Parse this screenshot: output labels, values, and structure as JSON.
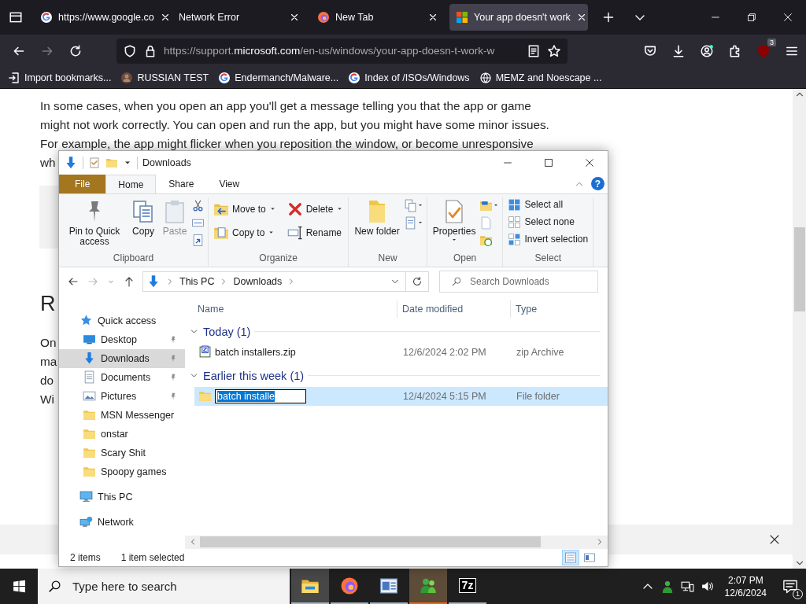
{
  "browser": {
    "tabs": [
      {
        "title": "https://www.google.co",
        "kind": "google",
        "selected": false
      },
      {
        "title": "Network Error",
        "kind": "none",
        "selected": false
      },
      {
        "title": "New Tab",
        "kind": "firefox",
        "selected": false
      },
      {
        "title": "Your app doesn't work",
        "kind": "microsoft",
        "selected": true
      }
    ],
    "forward": {
      "disabled": true
    },
    "url": {
      "scheme": "https://support.",
      "domain": "microsoft.com",
      "path": "/en-us/windows/your-app-doesn-t-work-w"
    },
    "extension_badge": "3",
    "bookmarks": [
      {
        "label": "Import bookmarks...",
        "kind": "import"
      },
      {
        "label": "RUSSIAN TEST",
        "kind": "avatar"
      },
      {
        "label": "Endermanch/Malware...",
        "kind": "google"
      },
      {
        "label": "Index of /ISOs/Windows",
        "kind": "google"
      },
      {
        "label": "MEMZ and Noescape ...",
        "kind": "globe"
      }
    ]
  },
  "page": {
    "intro_lines": [
      "In some cases, when you open an app you'll get a message telling you that the app or game",
      "might not work correctly. You can open and run the app, but you might have some minor issues.",
      "For example, the app might flicker when you reposition the window, or become unresponsive",
      "wh"
    ],
    "heading": "R",
    "body_lines": [
      "On",
      "ma",
      "do",
      "Wi"
    ]
  },
  "explorer": {
    "title": "Downloads",
    "help": "?",
    "ribbon_tabs": [
      {
        "label": "File",
        "kind": "file",
        "selected": false
      },
      {
        "label": "Home",
        "kind": "tab",
        "selected": true
      },
      {
        "label": "Share",
        "kind": "tab",
        "selected": false
      },
      {
        "label": "View",
        "kind": "tab",
        "selected": false
      }
    ],
    "ribbon_groups": [
      {
        "label": "Clipboard",
        "buttons": [
          {
            "label": "Pin to Quick access",
            "kind": "large",
            "dropdown": false,
            "disabled": false
          },
          {
            "label": "Copy",
            "kind": "large",
            "dropdown": false,
            "disabled": false
          },
          {
            "label": "Paste",
            "kind": "large",
            "dropdown": false,
            "disabled": true
          },
          {
            "kind": "stack"
          }
        ]
      },
      {
        "label": "Organize",
        "buttons": [
          {
            "label": "Move to",
            "kind": "small",
            "dropdown": true,
            "disabled": false
          },
          {
            "label": "Delete",
            "kind": "small",
            "dropdown": true,
            "disabled": false
          },
          {
            "label": "Copy to",
            "kind": "small",
            "dropdown": true,
            "disabled": false
          },
          {
            "label": "Rename",
            "kind": "small",
            "dropdown": false,
            "disabled": false
          }
        ]
      },
      {
        "label": "New",
        "buttons": [
          {
            "label": "New folder",
            "kind": "large",
            "dropdown": false,
            "disabled": false
          },
          {
            "kind": "stack"
          }
        ]
      },
      {
        "label": "Open",
        "buttons": [
          {
            "label": "Properties",
            "kind": "large",
            "dropdown": true,
            "disabled": false
          },
          {
            "kind": "stack"
          }
        ]
      },
      {
        "label": "Select",
        "buttons": [
          {
            "label": "Select all",
            "kind": "small",
            "dropdown": false,
            "disabled": false
          },
          {
            "label": "Select none",
            "kind": "small",
            "dropdown": false,
            "disabled": false
          },
          {
            "label": "Invert selection",
            "kind": "small",
            "dropdown": false,
            "disabled": false
          }
        ]
      }
    ],
    "breadcrumbs": [
      "This PC",
      "Downloads"
    ],
    "search": {
      "placeholder": "Search Downloads"
    },
    "nav": [
      {
        "label": "Quick access",
        "kind": "star",
        "selected": false,
        "children": [
          {
            "label": "Desktop",
            "kind": "desktop",
            "pinned": true,
            "selected": false
          },
          {
            "label": "Downloads",
            "kind": "download",
            "pinned": true,
            "selected": true
          },
          {
            "label": "Documents",
            "kind": "documents",
            "pinned": true,
            "selected": false
          },
          {
            "label": "Pictures",
            "kind": "pictures",
            "pinned": true,
            "selected": false
          },
          {
            "label": "MSN Messenger",
            "kind": "folder",
            "pinned": false,
            "selected": false
          },
          {
            "label": "onstar",
            "kind": "folder",
            "pinned": false,
            "selected": false
          },
          {
            "label": "Scary Shit",
            "kind": "folder",
            "pinned": false,
            "selected": false
          },
          {
            "label": "Spoopy games",
            "kind": "folder",
            "pinned": false,
            "selected": false
          }
        ]
      },
      {
        "label": "This PC",
        "kind": "pc",
        "selected": false
      },
      {
        "label": "Network",
        "kind": "network",
        "selected": false
      }
    ],
    "columns": [
      "Name",
      "Date modified",
      "Type"
    ],
    "groups": [
      {
        "label": "Today (1)",
        "expanded": true,
        "rows": [
          {
            "name": "batch installers.zip",
            "kind": "zip",
            "date": "12/6/2024 2:02 PM",
            "type": "zip Archive",
            "selected": false,
            "renaming": false
          }
        ]
      },
      {
        "label": "Earlier this week (1)",
        "expanded": true,
        "rows": [
          {
            "name": "batch installe",
            "kind": "folder",
            "date": "12/4/2024 5:15 PM",
            "type": "File folder",
            "selected": true,
            "renaming": true
          }
        ]
      }
    ],
    "status": {
      "count": "2 items",
      "selection": "1 item selected"
    },
    "views": [
      {
        "kind": "details",
        "selected": true
      },
      {
        "kind": "tiles",
        "selected": false
      }
    ]
  },
  "taskbar": {
    "placeholder": "Type here to search",
    "apps": [
      {
        "kind": "explorer",
        "active": true,
        "attention": false
      },
      {
        "kind": "firefox",
        "active": false,
        "attention": false
      },
      {
        "kind": "window",
        "active": false,
        "attention": false
      },
      {
        "kind": "msn",
        "active": false,
        "attention": true
      },
      {
        "kind": "sevenzip",
        "label": "7z",
        "active": false,
        "attention": false
      }
    ],
    "time": "2:07 PM",
    "date": "12/6/2024",
    "notifications": "1"
  }
}
